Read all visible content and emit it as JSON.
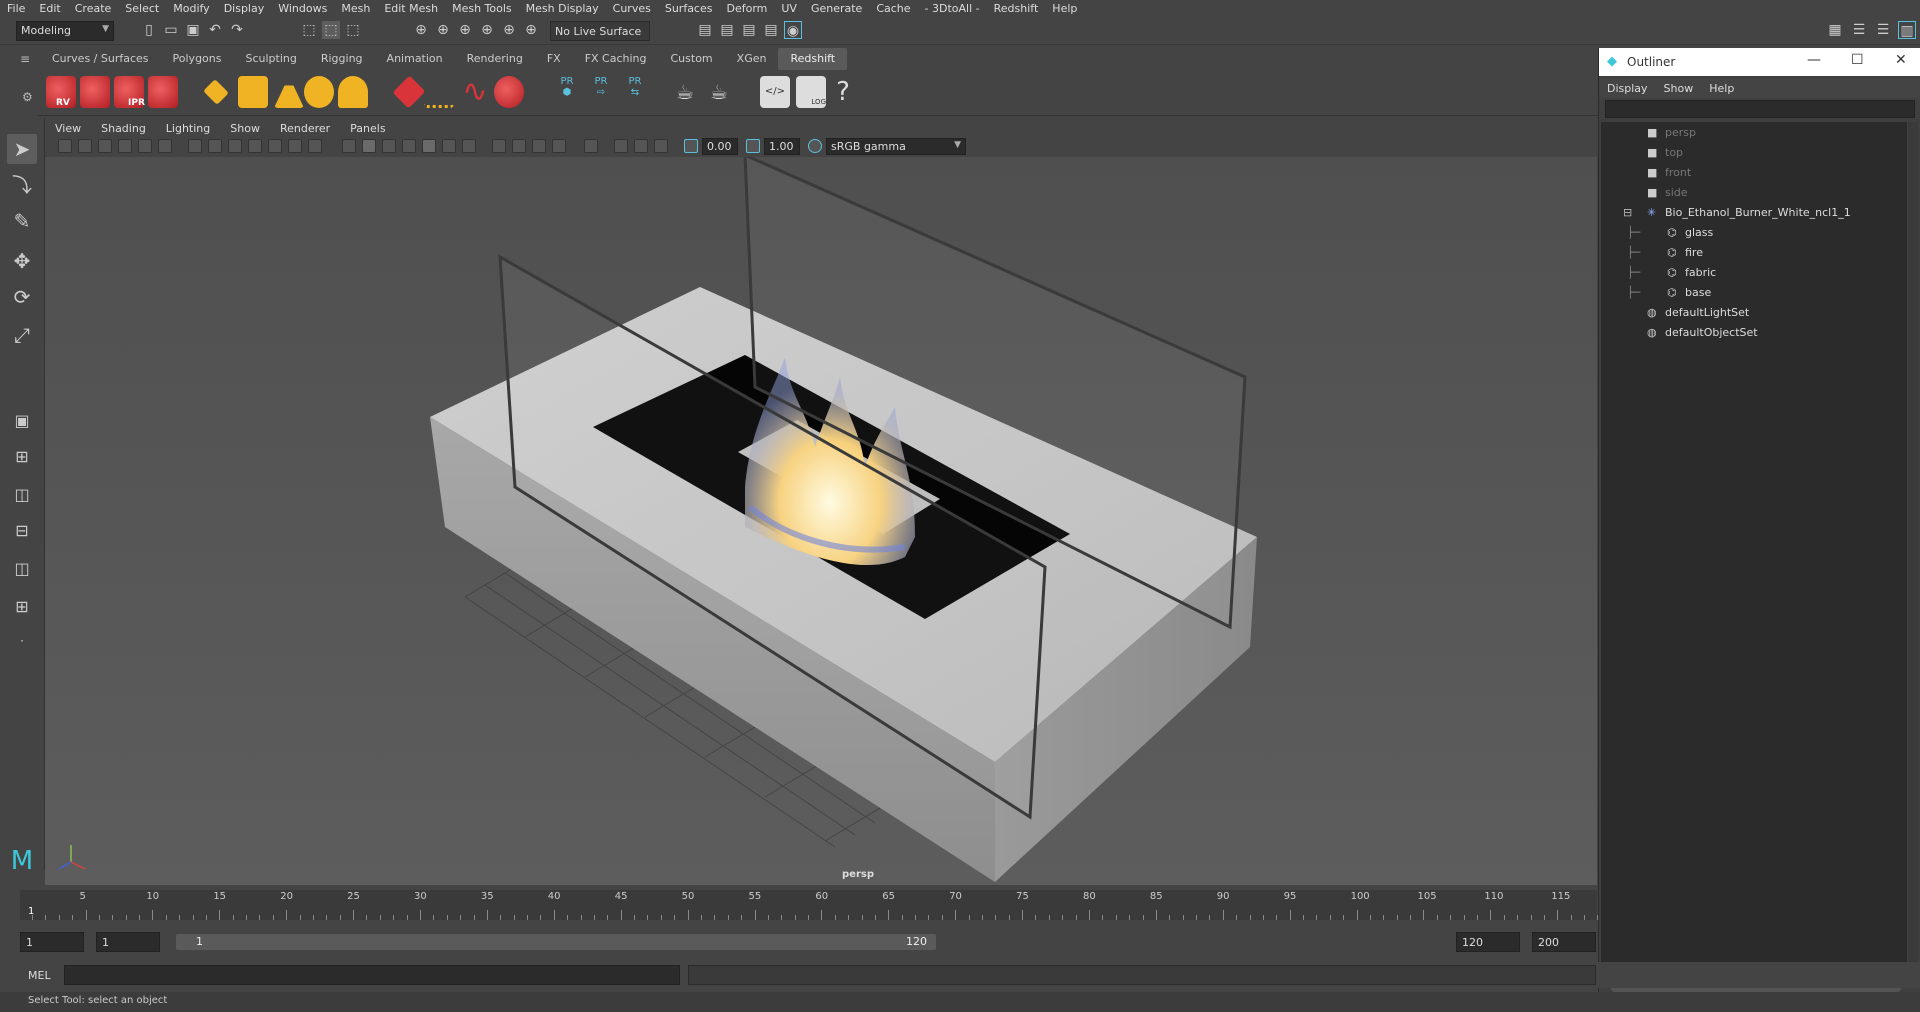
{
  "menubar": [
    "File",
    "Edit",
    "Create",
    "Select",
    "Modify",
    "Display",
    "Windows",
    "Mesh",
    "Edit Mesh",
    "Mesh Tools",
    "Mesh Display",
    "Curves",
    "Surfaces",
    "Deform",
    "UV",
    "Generate",
    "Cache",
    "- 3DtoAll -",
    "Redshift",
    "Help"
  ],
  "status": {
    "mode": "Modeling",
    "live_surface": "No Live Surface"
  },
  "shelf_tabs": [
    "Curves / Surfaces",
    "Polygons",
    "Sculpting",
    "Rigging",
    "Animation",
    "Rendering",
    "FX",
    "FX Caching",
    "Custom",
    "XGen",
    "Redshift"
  ],
  "shelf_active": "Redshift",
  "shelf_labels": {
    "rv": "RV",
    "ipr": "IPR",
    "pr1": "PR",
    "pr2": "PR",
    "pr3": "PR",
    "log": "LOG"
  },
  "panel_menu": [
    "View",
    "Shading",
    "Lighting",
    "Show",
    "Renderer",
    "Panels"
  ],
  "panel_toolbar": {
    "exposure": "0.00",
    "gamma": "1.00",
    "color_space": "sRGB gamma"
  },
  "viewport": {
    "camera_label": "persp"
  },
  "outliner": {
    "title": "Outliner",
    "menu": [
      "Display",
      "Show",
      "Help"
    ],
    "items": [
      {
        "label": "persp",
        "type": "camera",
        "dim": true
      },
      {
        "label": "top",
        "type": "camera",
        "dim": true
      },
      {
        "label": "front",
        "type": "camera",
        "dim": true
      },
      {
        "label": "side",
        "type": "camera",
        "dim": true
      },
      {
        "label": "Bio_Ethanol_Burner_White_ncl1_1",
        "type": "group",
        "dim": false
      },
      {
        "label": "glass",
        "type": "mesh",
        "dim": false
      },
      {
        "label": "fire",
        "type": "mesh",
        "dim": false
      },
      {
        "label": "fabric",
        "type": "mesh",
        "dim": false
      },
      {
        "label": "base",
        "type": "mesh",
        "dim": false
      },
      {
        "label": "defaultLightSet",
        "type": "set",
        "dim": false
      },
      {
        "label": "defaultObjectSet",
        "type": "set",
        "dim": false
      }
    ]
  },
  "timeline": {
    "ticks": [
      "5",
      "10",
      "15",
      "20",
      "25",
      "30",
      "35",
      "40",
      "45",
      "50",
      "55",
      "60",
      "65",
      "70",
      "75",
      "80",
      "85",
      "90",
      "95",
      "100",
      "105",
      "110",
      "115"
    ],
    "current": "1"
  },
  "range": {
    "start": "1",
    "anim_start": "1",
    "slider_start": "1",
    "slider_end": "120",
    "end": "120",
    "anim_end": "200"
  },
  "cmdline": {
    "label": "MEL"
  },
  "helpline": "Select Tool: select an object",
  "colors": {
    "accent": "#5bc0de",
    "redshift_red": "#d9343a",
    "shelf_yellow": "#f0b323",
    "highlight": "#5d5d5d"
  }
}
